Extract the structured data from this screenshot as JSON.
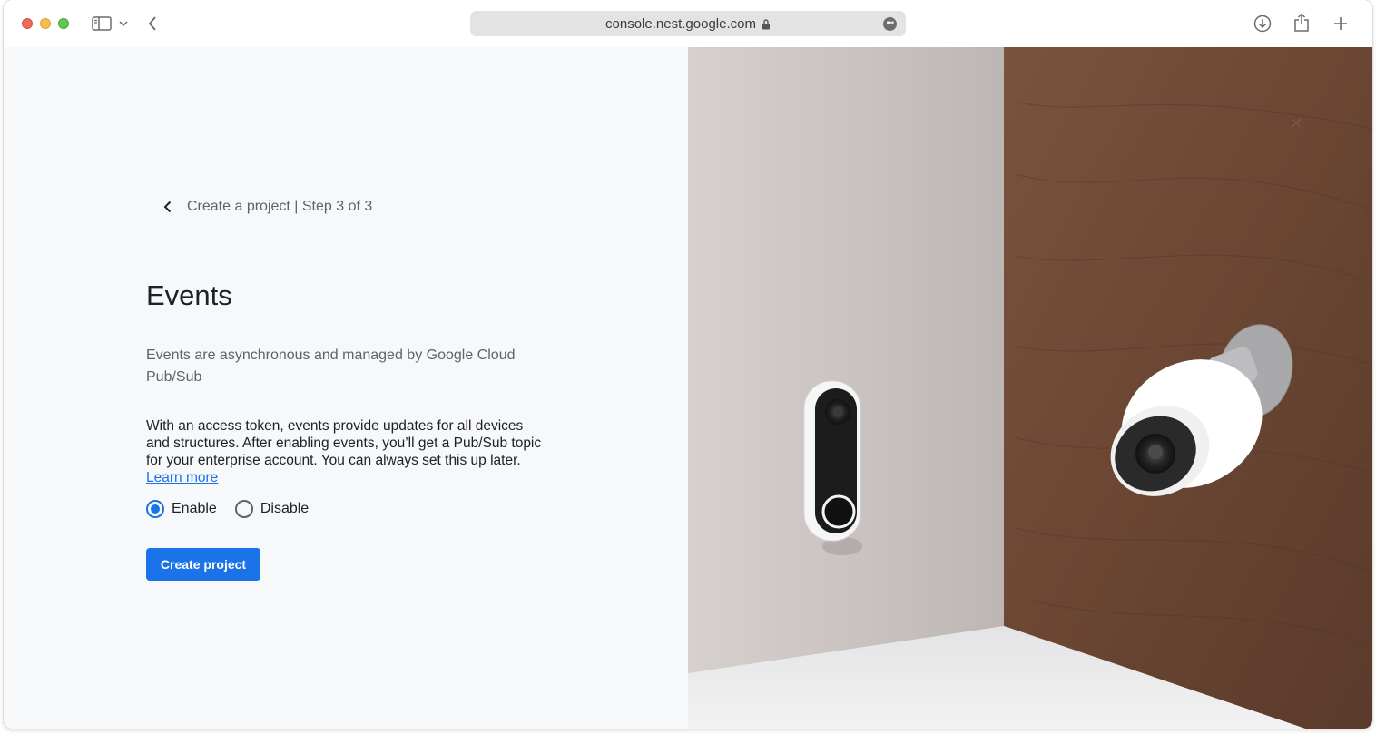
{
  "browser": {
    "url": "console.nest.google.com",
    "icons": {
      "sidebar": "sidebar-icon",
      "chevron": "chevron-down-icon",
      "back": "back-arrow-icon",
      "lock": "lock-icon",
      "more": "more-icon",
      "download": "download-icon",
      "share": "share-icon",
      "new_tab": "plus-icon"
    }
  },
  "wizard": {
    "step_label": "Create a project | Step 3 of 3",
    "title": "Events",
    "subtitle": "Events are asynchronous and managed by Google Cloud Pub/Sub",
    "body": "With an access token, events provide updates for all devices and structures. After enabling events, you’ll get a Pub/Sub topic for your enterprise account. You can always set this up later.",
    "learn_more": "Learn more",
    "options": [
      {
        "label": "Enable",
        "selected": true
      },
      {
        "label": "Disable",
        "selected": false
      }
    ],
    "create_button": "Create project"
  },
  "colors": {
    "accent": "#1a73e8",
    "pane_bg": "#f6f8fa",
    "wall_left": "#cdc7c5",
    "wood": "#6e4a36"
  }
}
